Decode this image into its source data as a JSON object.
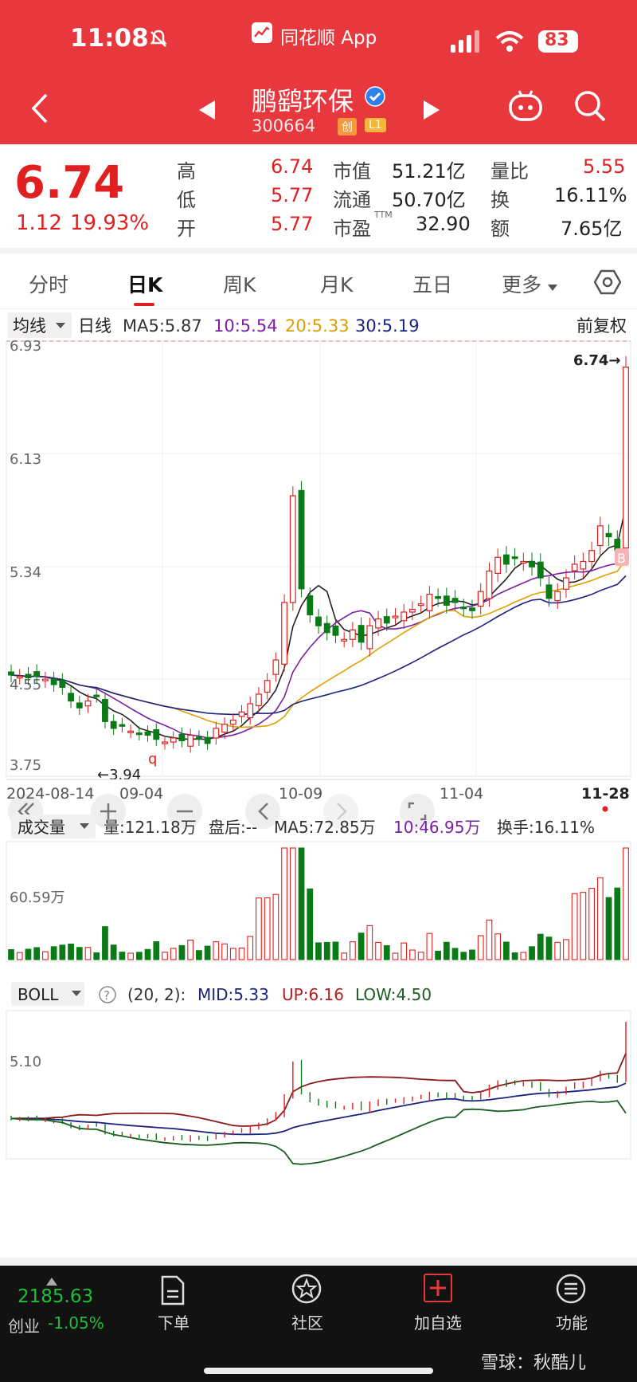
{
  "status_bar": {
    "time": "11:08",
    "app_name": "同花顺 App",
    "battery": "83"
  },
  "header": {
    "stock_name": "鹏鹞环保",
    "stock_code": "300664",
    "board_tag": "创",
    "level_tag": "L1"
  },
  "quote": {
    "price": "6.74",
    "change": "1.12",
    "change_pct": "19.93%",
    "rows": [
      {
        "k1": "高",
        "v1": "6.74",
        "k2": "市值",
        "v2": "51.21亿",
        "k3": "量比",
        "v3": "5.55"
      },
      {
        "k1": "低",
        "v1": "5.77",
        "k2": "流通",
        "v2": "50.70亿",
        "k3": "换",
        "v3": "16.11%"
      },
      {
        "k1": "开",
        "v1": "5.77",
        "k2": "市盈",
        "v2": "32.90",
        "k3": "额",
        "v3": "7.65亿"
      }
    ],
    "pe_sup": "TTM"
  },
  "tabs": [
    "分时",
    "日K",
    "周K",
    "月K",
    "五日",
    "更多"
  ],
  "active_tab": "日K",
  "ma_legend": {
    "dropdown": "均线",
    "period": "日线",
    "ma5": "MA5:5.87",
    "ma10": "10:5.54",
    "ma20": "20:5.33",
    "ma30": "30:5.19",
    "adjust": "前复权"
  },
  "kline": {
    "y_labels": [
      "6.93",
      "6.13",
      "5.34",
      "4.55",
      "3.75"
    ],
    "high_marker": "6.74→",
    "low_marker": "←3.94",
    "dates": [
      "2024-08-14",
      "09-04",
      "10-09",
      "11-04",
      "11-28"
    ],
    "buy_marker": "B",
    "q_marker": "q"
  },
  "volume": {
    "dropdown": "成交量",
    "vol": "量:121.18万",
    "after": "盘后:--",
    "ma5": "MA5:72.85万",
    "ma10": "10:46.95万",
    "turnover": "换手:16.11%",
    "y_label": "60.59万"
  },
  "boll": {
    "dropdown": "BOLL",
    "help": "?",
    "params": "(20, 2):",
    "mid": "MID:5.33",
    "up": "UP:6.16",
    "low": "LOW:4.50",
    "y_label": "5.10"
  },
  "bottom_nav": {
    "index_value": "2185.63",
    "index_name": "创业",
    "index_change": "-1.05%",
    "items": [
      "下单",
      "社区",
      "加自选",
      "功能"
    ],
    "watermark": "雪球：秋酷儿"
  },
  "colors": {
    "up": "#e02020",
    "down": "#0a7a16",
    "header": "#e8383d",
    "ma5": "#222222",
    "ma10": "#7b1fa2",
    "ma20": "#e0a000",
    "ma30": "#1a237e"
  },
  "chart_data": {
    "type": "candlestick",
    "series_name": "鹏鹞环保 日K",
    "x_ticks": [
      "2024-08-14",
      "09-04",
      "10-09",
      "11-04",
      "11-28"
    ],
    "ylim": [
      3.75,
      6.93
    ],
    "last_close": 6.74,
    "period_high": 6.74,
    "period_low": 3.94,
    "ma": {
      "MA5": 5.87,
      "MA10": 5.54,
      "MA20": 5.33,
      "MA30": 5.19
    },
    "closes": [
      4.49,
      4.48,
      4.47,
      4.48,
      4.46,
      4.42,
      4.4,
      4.3,
      4.25,
      4.3,
      4.34,
      4.15,
      4.1,
      4.12,
      4.08,
      4.06,
      4.05,
      4.02,
      4.0,
      4.03,
      4.01,
      4.05,
      4.02,
      3.99,
      4.1,
      4.13,
      4.16,
      4.22,
      4.28,
      4.35,
      4.45,
      4.6,
      5.02,
      5.8,
      5.12,
      4.93,
      4.85,
      4.8,
      4.78,
      4.75,
      4.82,
      4.73,
      4.85,
      4.9,
      4.87,
      4.92,
      4.95,
      4.97,
      5.01,
      5.08,
      5.05,
      5.0,
      5.02,
      4.98,
      4.96,
      5.1,
      5.25,
      5.35,
      5.3,
      5.35,
      5.32,
      5.28,
      5.2,
      5.05,
      5.1,
      5.2,
      5.3,
      5.32,
      5.4,
      5.58,
      5.5,
      5.4,
      6.74
    ]
  }
}
